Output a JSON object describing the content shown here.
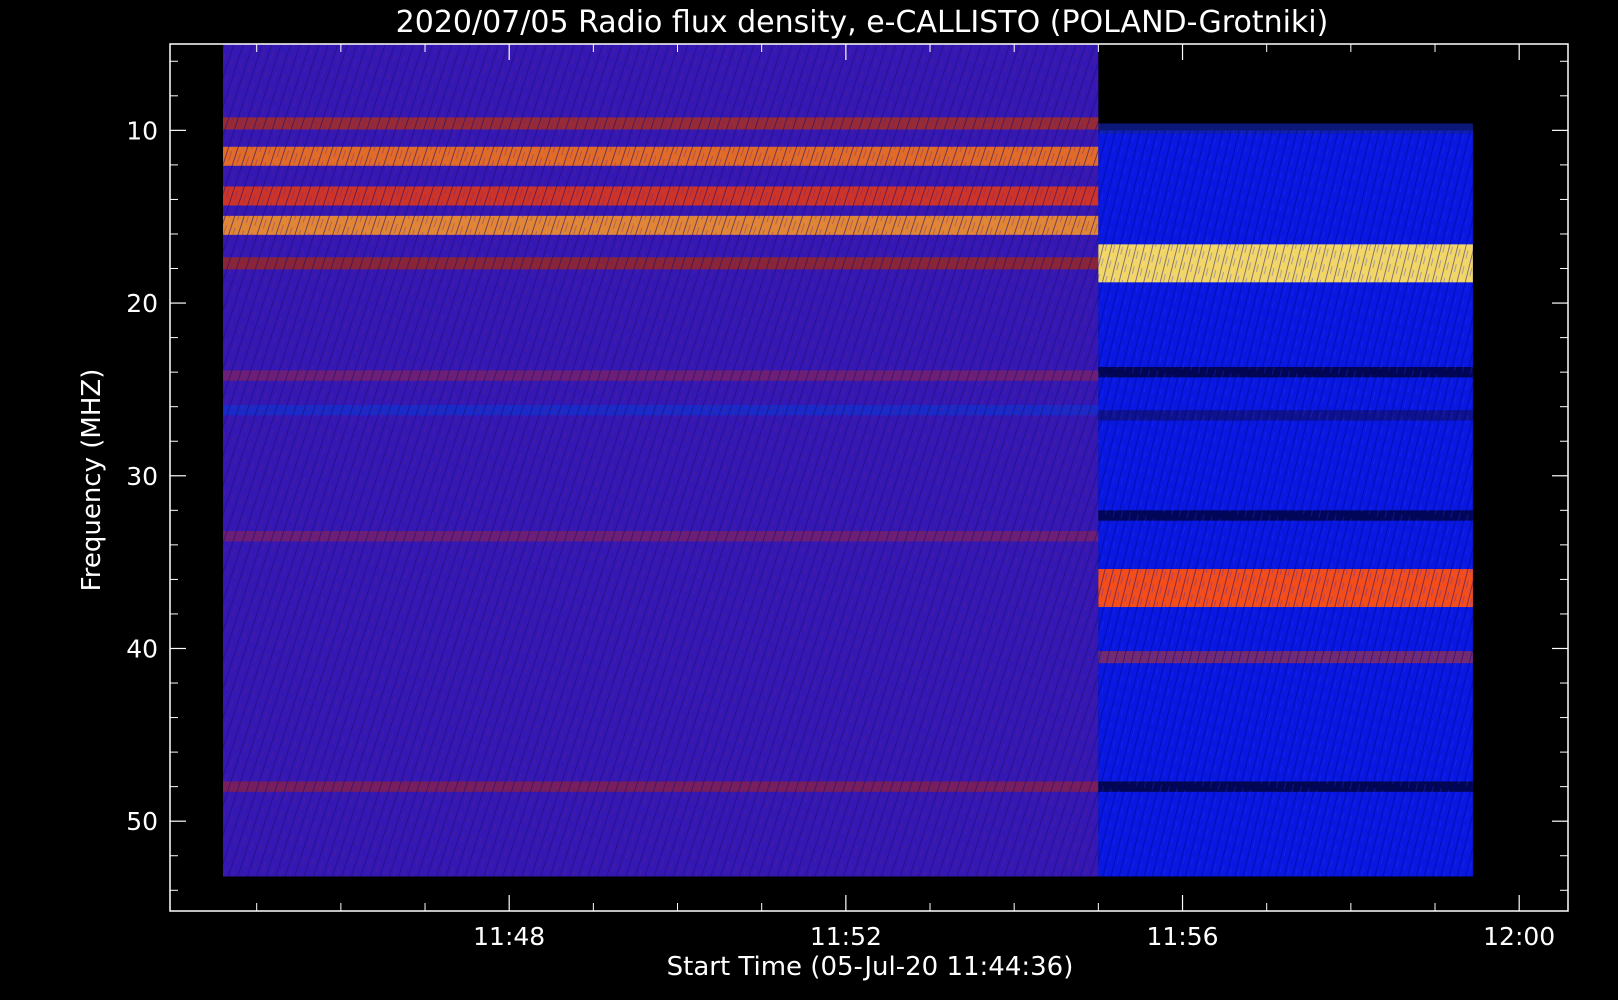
{
  "chart_data": {
    "type": "heatmap",
    "title": "2020/07/05  Radio flux density, e-CALLISTO (POLAND-Grotniki)",
    "xlabel": "Start Time (05-Jul-20 11:44:36)",
    "ylabel": "Frequency (MHZ)",
    "x_ticks": [
      {
        "value": "11:48",
        "minutes": 3.4
      },
      {
        "value": "11:52",
        "minutes": 7.4
      },
      {
        "value": "11:56",
        "minutes": 11.4
      },
      {
        "value": "12:00",
        "minutes": 15.4
      }
    ],
    "y_ticks": [
      10,
      20,
      30,
      40,
      50
    ],
    "xlim_minutes": [
      -0.63,
      15.98
    ],
    "ylim_mhz": [
      5,
      55.2
    ],
    "data_frequency_range_mhz": [
      10.0,
      53.2
    ],
    "x_minor_step_minutes": 1,
    "y_minor_step_mhz": 2,
    "y_axis_inverted": true,
    "segments": [
      {
        "name": "segment-1",
        "time_range_minutes": [
          0.0,
          10.4
        ],
        "freq_range_mhz": [
          5.0,
          53.2
        ],
        "background_color": "#3518b4",
        "bands": [
          {
            "mhz": 9.6,
            "level": "medium",
            "color": "#b03018"
          },
          {
            "mhz": 11.5,
            "level": "high",
            "color": "#ff7a10"
          },
          {
            "mhz": 13.8,
            "level": "high",
            "color": "#e83a10"
          },
          {
            "mhz": 15.5,
            "level": "high",
            "color": "#ff9a20"
          },
          {
            "mhz": 17.7,
            "level": "medium",
            "color": "#a02818"
          },
          {
            "mhz": 24.2,
            "level": "low",
            "color": "#802060"
          },
          {
            "mhz": 26.2,
            "level": "low",
            "color": "#1030d0"
          },
          {
            "mhz": 33.5,
            "level": "low",
            "color": "#802060"
          },
          {
            "mhz": 48.0,
            "level": "low",
            "color": "#902040"
          }
        ]
      },
      {
        "name": "segment-2",
        "time_range_minutes": [
          10.4,
          14.85
        ],
        "freq_range_mhz": [
          10.0,
          53.2
        ],
        "background_color": "#0818e0",
        "bands": [
          {
            "mhz": 9.9,
            "level": "low",
            "color": "#1020a0"
          },
          {
            "mhz": 17.7,
            "level": "very high",
            "color": "#ffe060"
          },
          {
            "mhz": 24.0,
            "level": "low",
            "color": "#000020"
          },
          {
            "mhz": 26.5,
            "level": "low",
            "color": "#101070"
          },
          {
            "mhz": 32.3,
            "level": "low",
            "color": "#000028"
          },
          {
            "mhz": 36.5,
            "level": "very high",
            "color": "#ff5010"
          },
          {
            "mhz": 40.5,
            "level": "medium",
            "color": "#903050"
          },
          {
            "mhz": 48.0,
            "level": "low",
            "color": "#000020"
          }
        ]
      }
    ]
  }
}
